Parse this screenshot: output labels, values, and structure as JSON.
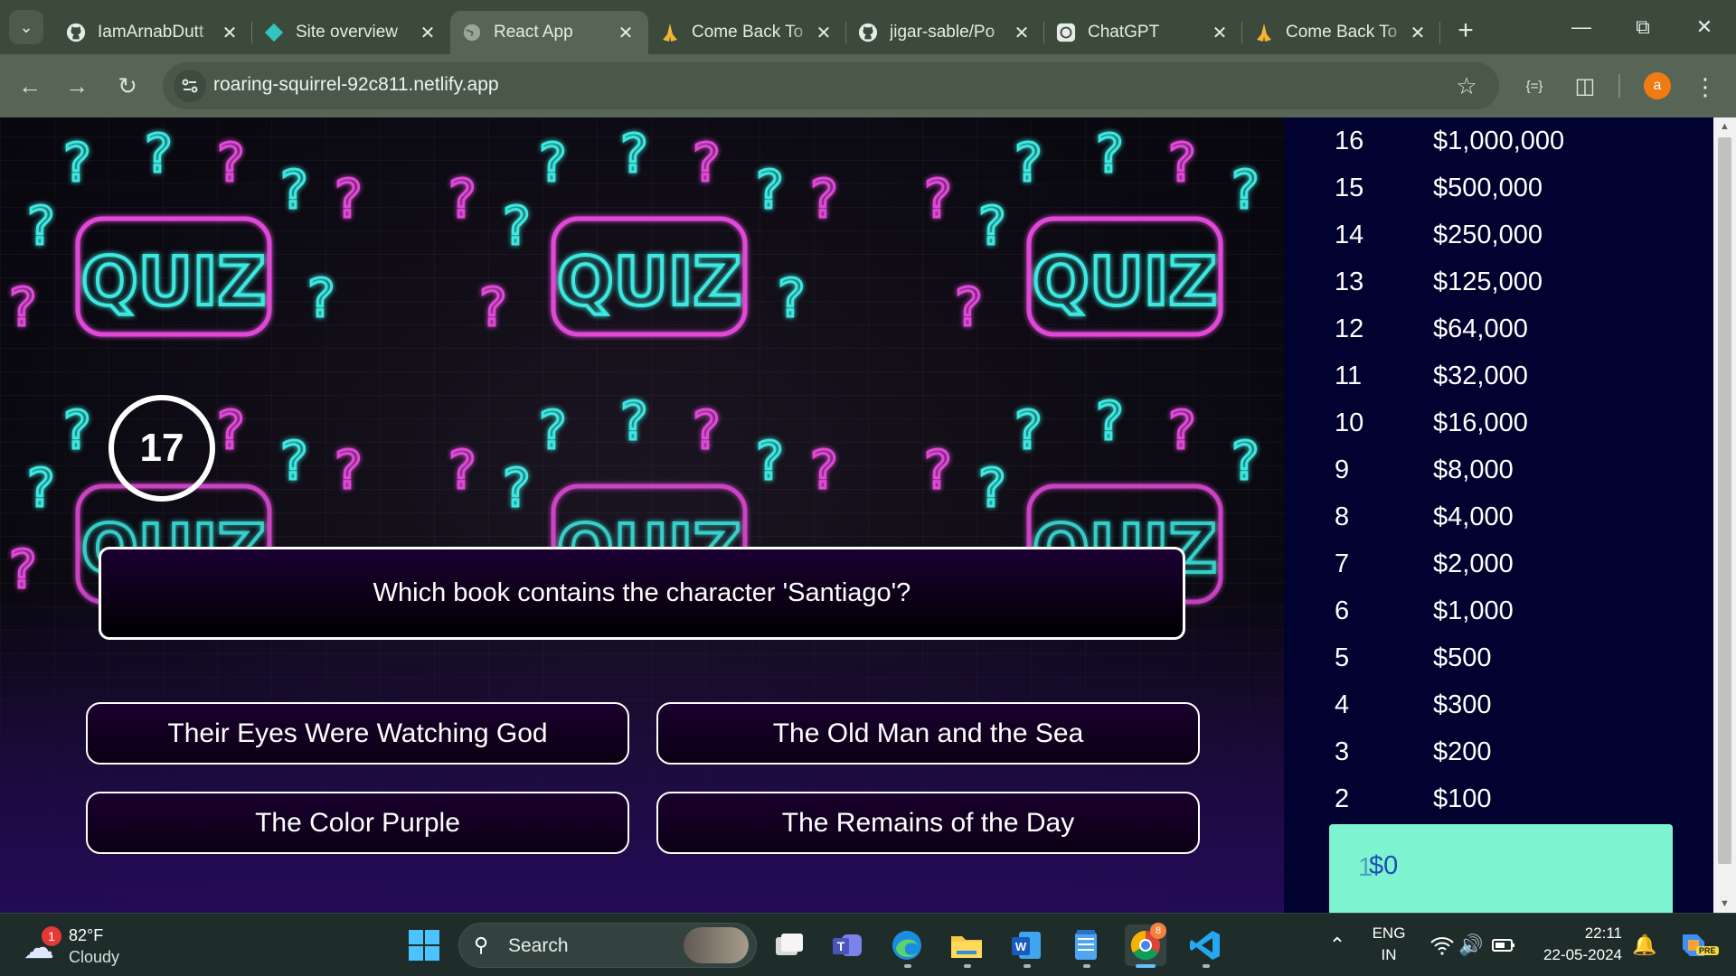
{
  "browser": {
    "tabs": [
      {
        "title": "IamArnabDutt",
        "icon": "github-icon",
        "active": false
      },
      {
        "title": "Site overview",
        "icon": "netlify-icon",
        "active": false
      },
      {
        "title": "React App",
        "icon": "globe-icon",
        "active": true
      },
      {
        "title": "Come Back To",
        "icon": "pray-hands-icon",
        "active": false
      },
      {
        "title": "jigar-sable/Po",
        "icon": "github-icon",
        "active": false
      },
      {
        "title": "ChatGPT",
        "icon": "openai-icon",
        "active": false
      },
      {
        "title": "Come Back To",
        "icon": "pray-hands-icon",
        "active": false
      }
    ],
    "url": "roaring-squirrel-92c811.netlify.app",
    "profile_initial": "a",
    "ext_label": "{=}"
  },
  "quiz": {
    "timer": "17",
    "question": "Which book contains the character 'Santiago'?",
    "answers": [
      "Their Eyes Were Watching God",
      "The Old Man and the Sea",
      "The Color Purple",
      "The Remains of the Day"
    ],
    "background_sign_text": "QUIZ"
  },
  "money_pyramid": [
    {
      "id": "16",
      "amount": "$1,000,000"
    },
    {
      "id": "15",
      "amount": "$500,000"
    },
    {
      "id": "14",
      "amount": "$250,000"
    },
    {
      "id": "13",
      "amount": "$125,000"
    },
    {
      "id": "12",
      "amount": "$64,000"
    },
    {
      "id": "11",
      "amount": "$32,000"
    },
    {
      "id": "10",
      "amount": "$16,000"
    },
    {
      "id": "9",
      "amount": "$8,000"
    },
    {
      "id": "8",
      "amount": "$4,000"
    },
    {
      "id": "7",
      "amount": "$2,000"
    },
    {
      "id": "6",
      "amount": "$1,000"
    },
    {
      "id": "5",
      "amount": "$500"
    },
    {
      "id": "4",
      "amount": "$300"
    },
    {
      "id": "3",
      "amount": "$200"
    },
    {
      "id": "2",
      "amount": "$100"
    }
  ],
  "current_level": {
    "id": "1",
    "amount": "$0"
  },
  "colors": {
    "pyramid_bg": "#020230",
    "active_level_bg": "#7ef3d0",
    "neon_cyan": "#3de8e0",
    "neon_pink": "#e04ad8"
  },
  "taskbar": {
    "weather_temp": "82°F",
    "weather_cond": "Cloudy",
    "weather_badge": "1",
    "search_label": "Search",
    "lang_top": "ENG",
    "lang_bottom": "IN",
    "time": "22:11",
    "date": "22-05-2024",
    "chrome_badge": "8",
    "copilot_badge": "PRE"
  }
}
